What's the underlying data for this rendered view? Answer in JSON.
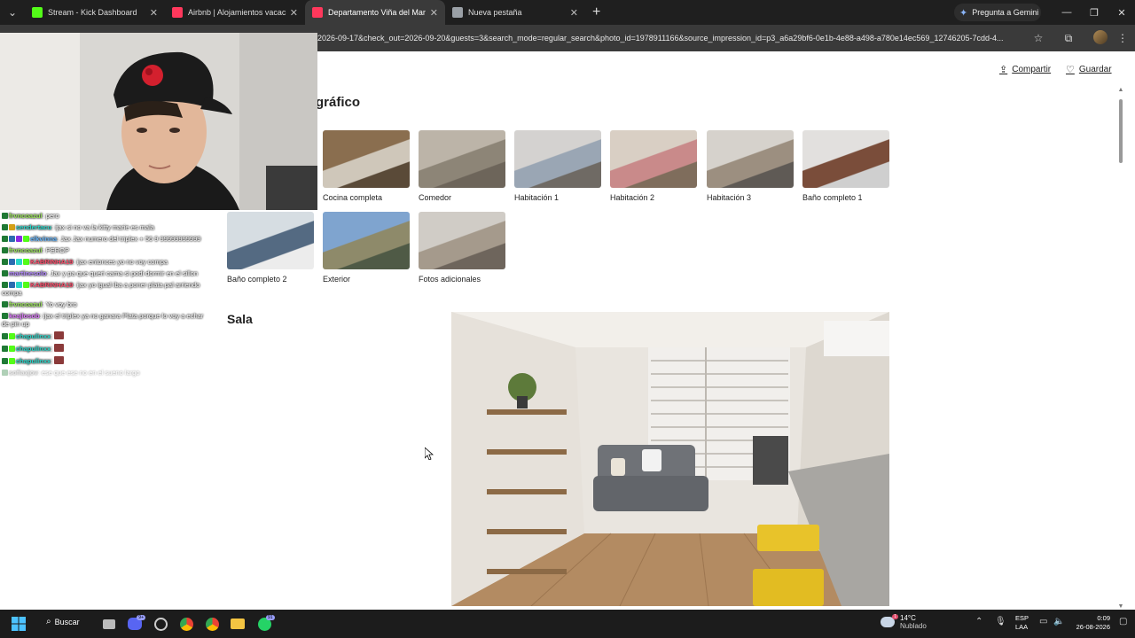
{
  "browser": {
    "tabs": [
      {
        "title": "Stream - Kick Dashboard",
        "favicon_color": "#53fc18",
        "active": false
      },
      {
        "title": "Airbnb | Alojamientos vacacionales",
        "favicon_color": "#ff385c",
        "active": false
      },
      {
        "title": "Departamento Viña del Mar - Airbnb",
        "favicon_color": "#ff385c",
        "active": true
      },
      {
        "title": "Nueva pestaña",
        "favicon_color": "#9aa0a6",
        "active": false
      }
    ],
    "new_tab_label": "+",
    "gemini_label": "Pregunta a Gemini",
    "url": "2026-09-17&check_out=2026-09-20&guests=3&search_mode=regular_search&photo_id=1978911166&source_impression_id=p3_a6a29bf6-0e1b-4e88-a498-a780e14ec569_12746205-7cdd-4..."
  },
  "page": {
    "share_label": "Compartir",
    "save_label": "Guardar",
    "heading": "gráfico",
    "thumbnails": [
      {
        "caption": "Cocina completa",
        "colors": [
          "#8a6e4f",
          "#cfc7ba",
          "#5a4a38"
        ]
      },
      {
        "caption": "Comedor",
        "colors": [
          "#bcb4a8",
          "#8d8577",
          "#6d655a"
        ]
      },
      {
        "caption": "Habitación 1",
        "colors": [
          "#d4d2d0",
          "#9aa6b4",
          "#6f6a64"
        ]
      },
      {
        "caption": "Habitación 2",
        "colors": [
          "#d9cfc4",
          "#c98a8a",
          "#7f6d5c"
        ]
      },
      {
        "caption": "Habitación 3",
        "colors": [
          "#d6d2cc",
          "#9c8f80",
          "#5f5a55"
        ]
      },
      {
        "caption": "Baño completo 1",
        "colors": [
          "#e2e0de",
          "#7a4d3a",
          "#cfcfcf"
        ]
      },
      {
        "caption": "Baño completo 2",
        "colors": [
          "#d6dde2",
          "#546a82",
          "#ececec"
        ]
      },
      {
        "caption": "Exterior",
        "colors": [
          "#7fa4cf",
          "#8e8a6a",
          "#4f5a46"
        ]
      },
      {
        "caption": "Fotos adicionales",
        "colors": [
          "#d0ccc6",
          "#a59a8c",
          "#6e655c"
        ]
      }
    ],
    "section_title": "Sala"
  },
  "stream": {
    "chat": [
      {
        "user": "frvncoazul",
        "color": "#9ae65a",
        "text": "pero",
        "badges": [
          "#1f7a35"
        ]
      },
      {
        "user": "sendertacu",
        "color": "#2bd6c9",
        "text": "ijax si no va la kitty marie es mala",
        "badges": [
          "#1f7a35",
          "#d4a017"
        ]
      },
      {
        "user": "elkvinna",
        "color": "#67b8ff",
        "text": "Jax Jax numero del triplex + 56 9 99999999999",
        "badges": [
          "#1f7a35",
          "#2b6cb0",
          "#8a2be2",
          "#53fc18"
        ]
      },
      {
        "user": "frvncoazul",
        "color": "#9ae65a",
        "text": "PEROP",
        "badges": [
          "#1f7a35"
        ]
      },
      {
        "user": "KABRINHA19",
        "color": "#ff4f6d",
        "text": "ijax entonces yo no voy compa",
        "badges": [
          "#1f7a35",
          "#2b6cb0",
          "#2bd6c9",
          "#53fc18"
        ]
      },
      {
        "user": "martinesolo",
        "color": "#b388ff",
        "text": "Jax y pa que queri cama si podi dormir en el sillon",
        "badges": [
          "#1f7a35"
        ]
      },
      {
        "user": "KABRINHA19",
        "color": "#ff4f6d",
        "text": "ijax yo igual iba a poner plata pal arriendo compa",
        "badges": [
          "#1f7a35",
          "#2b6cb0",
          "#2bd6c9",
          "#53fc18"
        ]
      },
      {
        "user": "frvncoazul",
        "color": "#9ae65a",
        "text": "Yo voy bro",
        "badges": [
          "#1f7a35"
        ]
      },
      {
        "user": "keajlosob",
        "color": "#e07bff",
        "text": "ijax el triplex ya no ganara Plata porque lo voy a echar de pin up",
        "badges": [
          "#1f7a35"
        ]
      },
      {
        "user": "chapulinxx",
        "color": "#2bd6c9",
        "text": "",
        "badges": [
          "#1f7a35",
          "#53fc18"
        ],
        "emote": true
      },
      {
        "user": "chapulinxx",
        "color": "#2bd6c9",
        "text": "",
        "badges": [
          "#1f7a35",
          "#53fc18"
        ],
        "emote": true
      },
      {
        "user": "chapulinxx",
        "color": "#2bd6c9",
        "text": "",
        "badges": [
          "#1f7a35",
          "#53fc18"
        ],
        "emote": true
      },
      {
        "user": "sofiaxjov",
        "color": "#bbbbbb",
        "text": "ese que ese no en el sueno largo",
        "badges": [
          "#1f7a35"
        ],
        "faded": true
      }
    ]
  },
  "taskbar": {
    "search_label": "Buscar",
    "weather_temp": "14°C",
    "weather_desc": "Nublado",
    "lang_top": "ESP",
    "lang_bottom": "LAA",
    "time": "0:09",
    "date": "26-08-2026",
    "discord_badge": "9+",
    "whatsapp_badge": "91",
    "weather_badge": "1"
  }
}
